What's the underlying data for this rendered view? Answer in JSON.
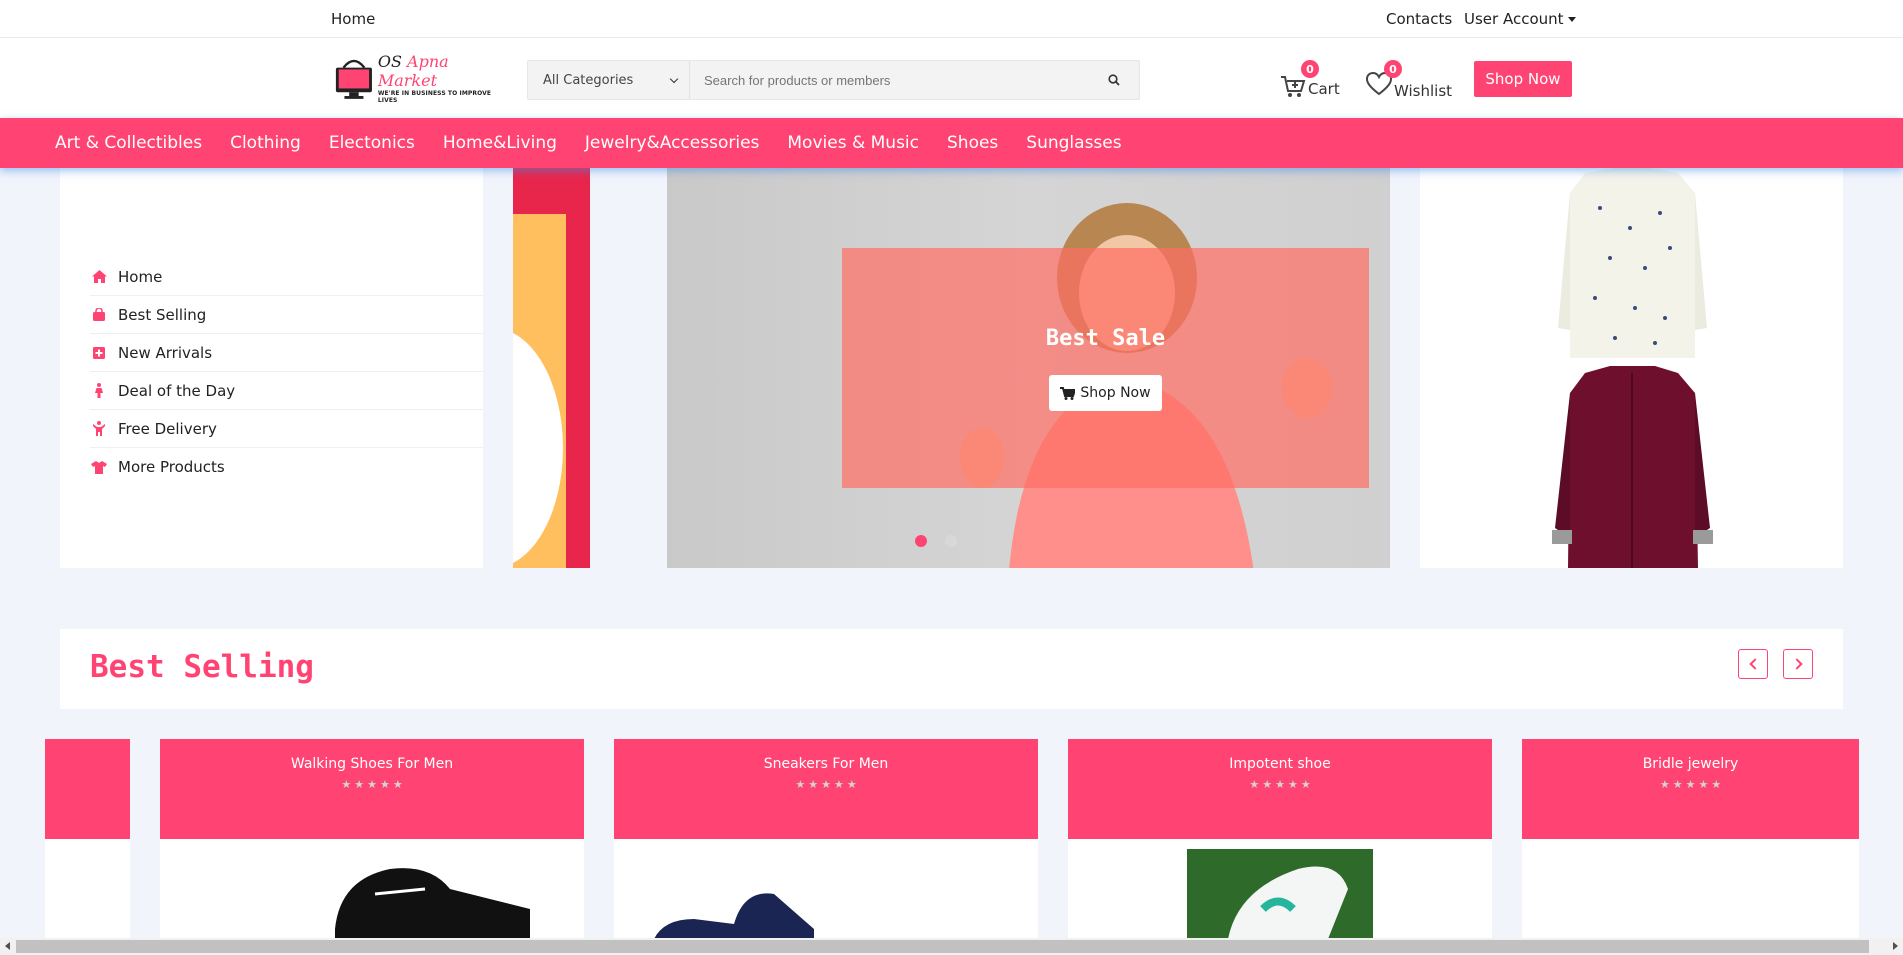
{
  "topbar": {
    "home": "Home",
    "contacts": "Contacts",
    "account": "User Account"
  },
  "logo": {
    "prefix": "OS ",
    "brand": "Apna Market",
    "tagline": "WE'RE IN BUSINESS TO IMPROVE LIVES"
  },
  "search": {
    "category": "All Categories",
    "placeholder": "Search for products or members"
  },
  "cart": {
    "label": "Cart",
    "count": "0"
  },
  "wishlist": {
    "label": "Wishlist",
    "count": "0"
  },
  "header_button": "Shop Now",
  "categories": [
    "Art & Collectibles",
    "Clothing",
    "Electonics",
    "Home&Living",
    "Jewelry&Accessories",
    "Movies & Music",
    "Shoes",
    "Sunglasses"
  ],
  "sidebar": [
    {
      "label": "Home",
      "icon": "home-icon"
    },
    {
      "label": "Best Selling",
      "icon": "shopping-bag-icon"
    },
    {
      "label": "New Arrivals",
      "icon": "plus-square-icon"
    },
    {
      "label": "Deal of the Day",
      "icon": "female-icon"
    },
    {
      "label": "Free Delivery",
      "icon": "child-icon"
    },
    {
      "label": "More Products",
      "icon": "tshirt-icon"
    }
  ],
  "banner": {
    "title": "Best Sale",
    "button": "Shop Now",
    "slides": 2,
    "active": 1
  },
  "best_selling": {
    "title": "Best Selling",
    "products": [
      {
        "name": "Walking Shoes For Men",
        "rating": 0
      },
      {
        "name": "Sneakers For Men",
        "rating": 0
      },
      {
        "name": "Impotent shoe",
        "rating": 0
      },
      {
        "name": "Bridle jewelry",
        "rating": 0
      }
    ]
  },
  "colors": {
    "accent": "#ff4473"
  }
}
